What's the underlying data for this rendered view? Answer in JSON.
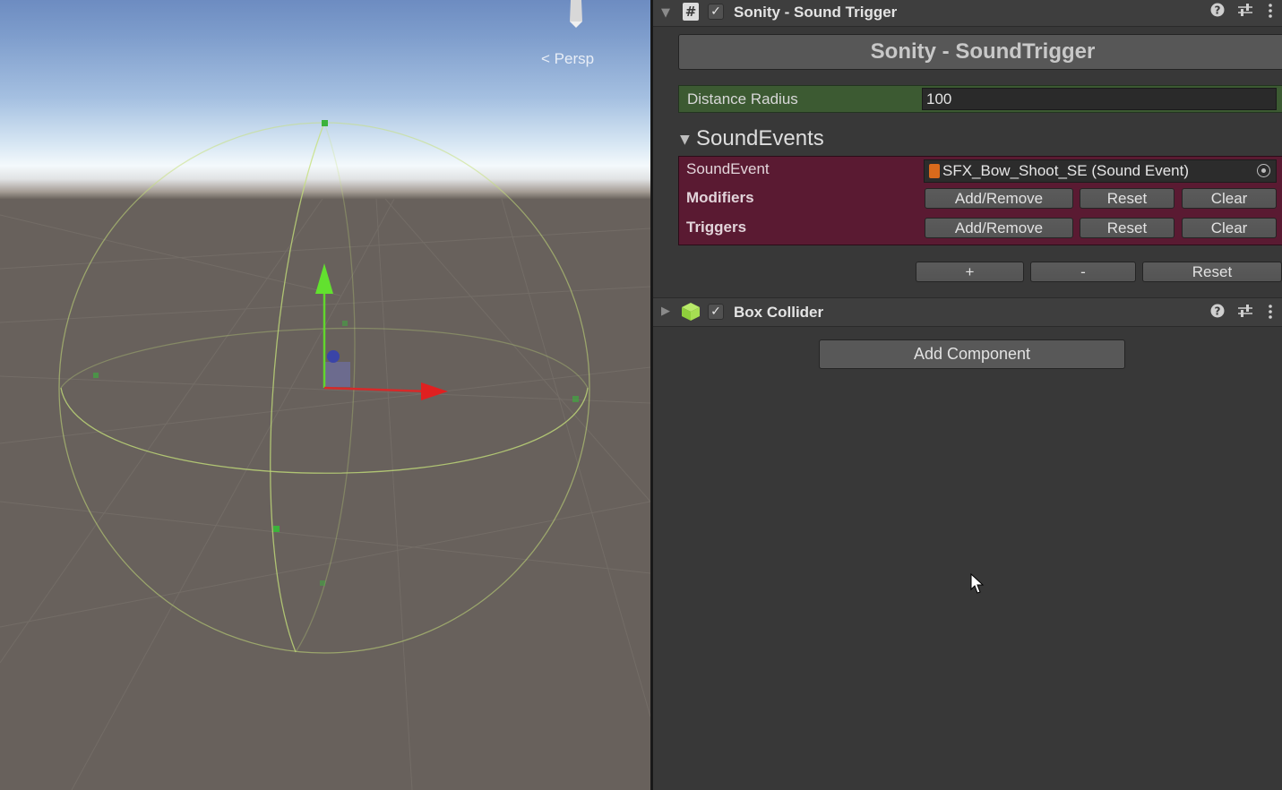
{
  "scene": {
    "persp_label": "Persp"
  },
  "inspector": {
    "sound_trigger": {
      "title": "Sonity - Sound Trigger",
      "big_button": "Sonity - SoundTrigger",
      "distance_radius_label": "Distance Radius",
      "distance_radius_value": "100",
      "events_title": "SoundEvents",
      "sound_event_label": "SoundEvent",
      "sound_event_value": "SFX_Bow_Shoot_SE (Sound Event)",
      "modifiers_label": "Modifiers",
      "triggers_label": "Triggers",
      "add_remove": "Add/Remove",
      "reset": "Reset",
      "clear": "Clear",
      "list_add": "+",
      "list_remove": "-",
      "list_reset": "Reset"
    },
    "box_collider": {
      "title": "Box Collider"
    },
    "add_component": "Add Component"
  }
}
